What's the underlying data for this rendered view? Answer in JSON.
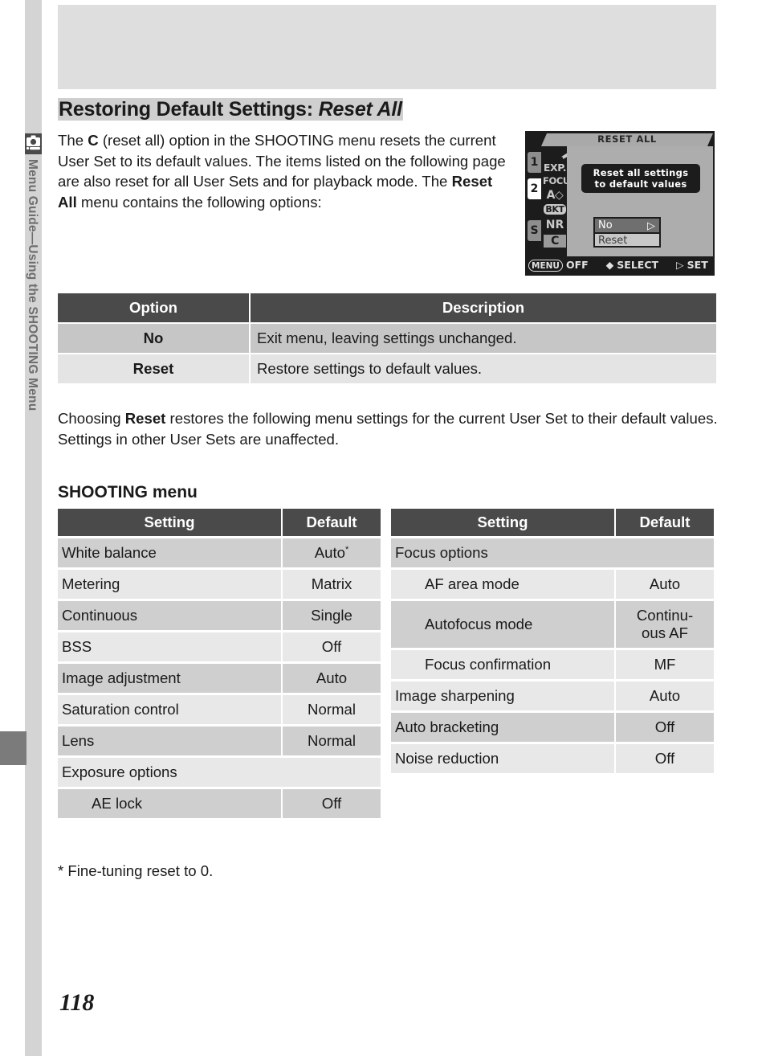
{
  "sidebar": {
    "icon": "camera-icon",
    "label": "Menu Guide—Using the SHOOTING Menu"
  },
  "heading": {
    "title_main": "Restoring Default Settings: ",
    "title_italic": "Reset All"
  },
  "intro_paragraph": {
    "part1": "The ",
    "bold1": "C",
    "part2": " (reset all) option in the SHOOTING menu  resets the current User Set to its default values. The items listed on the following page are also reset for all User Sets and for playback mode. The ",
    "bold2": "Reset All",
    "part3": " menu contains the following options:"
  },
  "lcd": {
    "title": "RESET ALL",
    "message_line1": "Reset all settings",
    "message_line2": "to default values",
    "tabs": [
      "1",
      "2",
      "S"
    ],
    "selected_tab": "2",
    "icons": [
      "EXP.",
      "FOCUS",
      "A◇",
      "BKT",
      "NR",
      "C"
    ],
    "selected_icon": "C",
    "choices": [
      {
        "label": "No",
        "arrow": "▷",
        "selected": true
      },
      {
        "label": "Reset",
        "arrow": "",
        "selected": false
      }
    ],
    "footer": {
      "menu_button": "MENU",
      "menu_action": "OFF",
      "select_icon": "◆",
      "select_action": "SELECT",
      "set_icon": "▷",
      "set_action": "SET"
    }
  },
  "options_table": {
    "headers": [
      "Option",
      "Description"
    ],
    "rows": [
      {
        "option": "No",
        "description": "Exit menu, leaving settings unchanged."
      },
      {
        "option": "Reset",
        "description": "Restore settings to default values."
      }
    ]
  },
  "choose_paragraph": {
    "part1": "Choosing ",
    "bold1": "Reset",
    "part2": " restores the following menu settings for the current User Set to their default values.  Settings in other User Sets are unaffected."
  },
  "section_heading": "SHOOTING menu",
  "shooting_table_left": {
    "headers": [
      "Setting",
      "Default"
    ],
    "rows": [
      {
        "setting": "White balance",
        "default": "Auto",
        "superscript": "*",
        "indent": false
      },
      {
        "setting": "Metering",
        "default": "Matrix",
        "indent": false
      },
      {
        "setting": "Continuous",
        "default": "Single",
        "indent": false
      },
      {
        "setting": "BSS",
        "default": "Off",
        "indent": false
      },
      {
        "setting": "Image adjustment",
        "default": "Auto",
        "indent": false
      },
      {
        "setting": "Saturation control",
        "default": "Normal",
        "indent": false
      },
      {
        "setting": "Lens",
        "default": "Normal",
        "indent": false
      },
      {
        "setting": "Exposure options",
        "default": "",
        "indent": false
      },
      {
        "setting": "AE lock",
        "default": "Off",
        "indent": true
      }
    ]
  },
  "shooting_table_right": {
    "headers": [
      "Setting",
      "Default"
    ],
    "rows": [
      {
        "setting": "Focus options",
        "default": "",
        "indent": false
      },
      {
        "setting": "AF area mode",
        "default": "Auto",
        "indent": true
      },
      {
        "setting": "Autofocus mode",
        "default": "Continu-\nous AF",
        "indent": true
      },
      {
        "setting": "Focus confirmation",
        "default": "MF",
        "indent": true
      },
      {
        "setting": "Image sharpening",
        "default": "Auto",
        "indent": false
      },
      {
        "setting": "Auto bracketing",
        "default": "Off",
        "indent": false
      },
      {
        "setting": "Noise reduction",
        "default": "Off",
        "indent": false
      }
    ]
  },
  "footnote": "* Fine-tuning reset to 0.",
  "page_number": "118",
  "colors": {
    "header_dark": "#4a4a4a",
    "row_dark": "#cfcfcf",
    "row_light": "#e8e8e8",
    "sidebar_grey": "#d4d4d4",
    "top_box": "#dedede"
  }
}
